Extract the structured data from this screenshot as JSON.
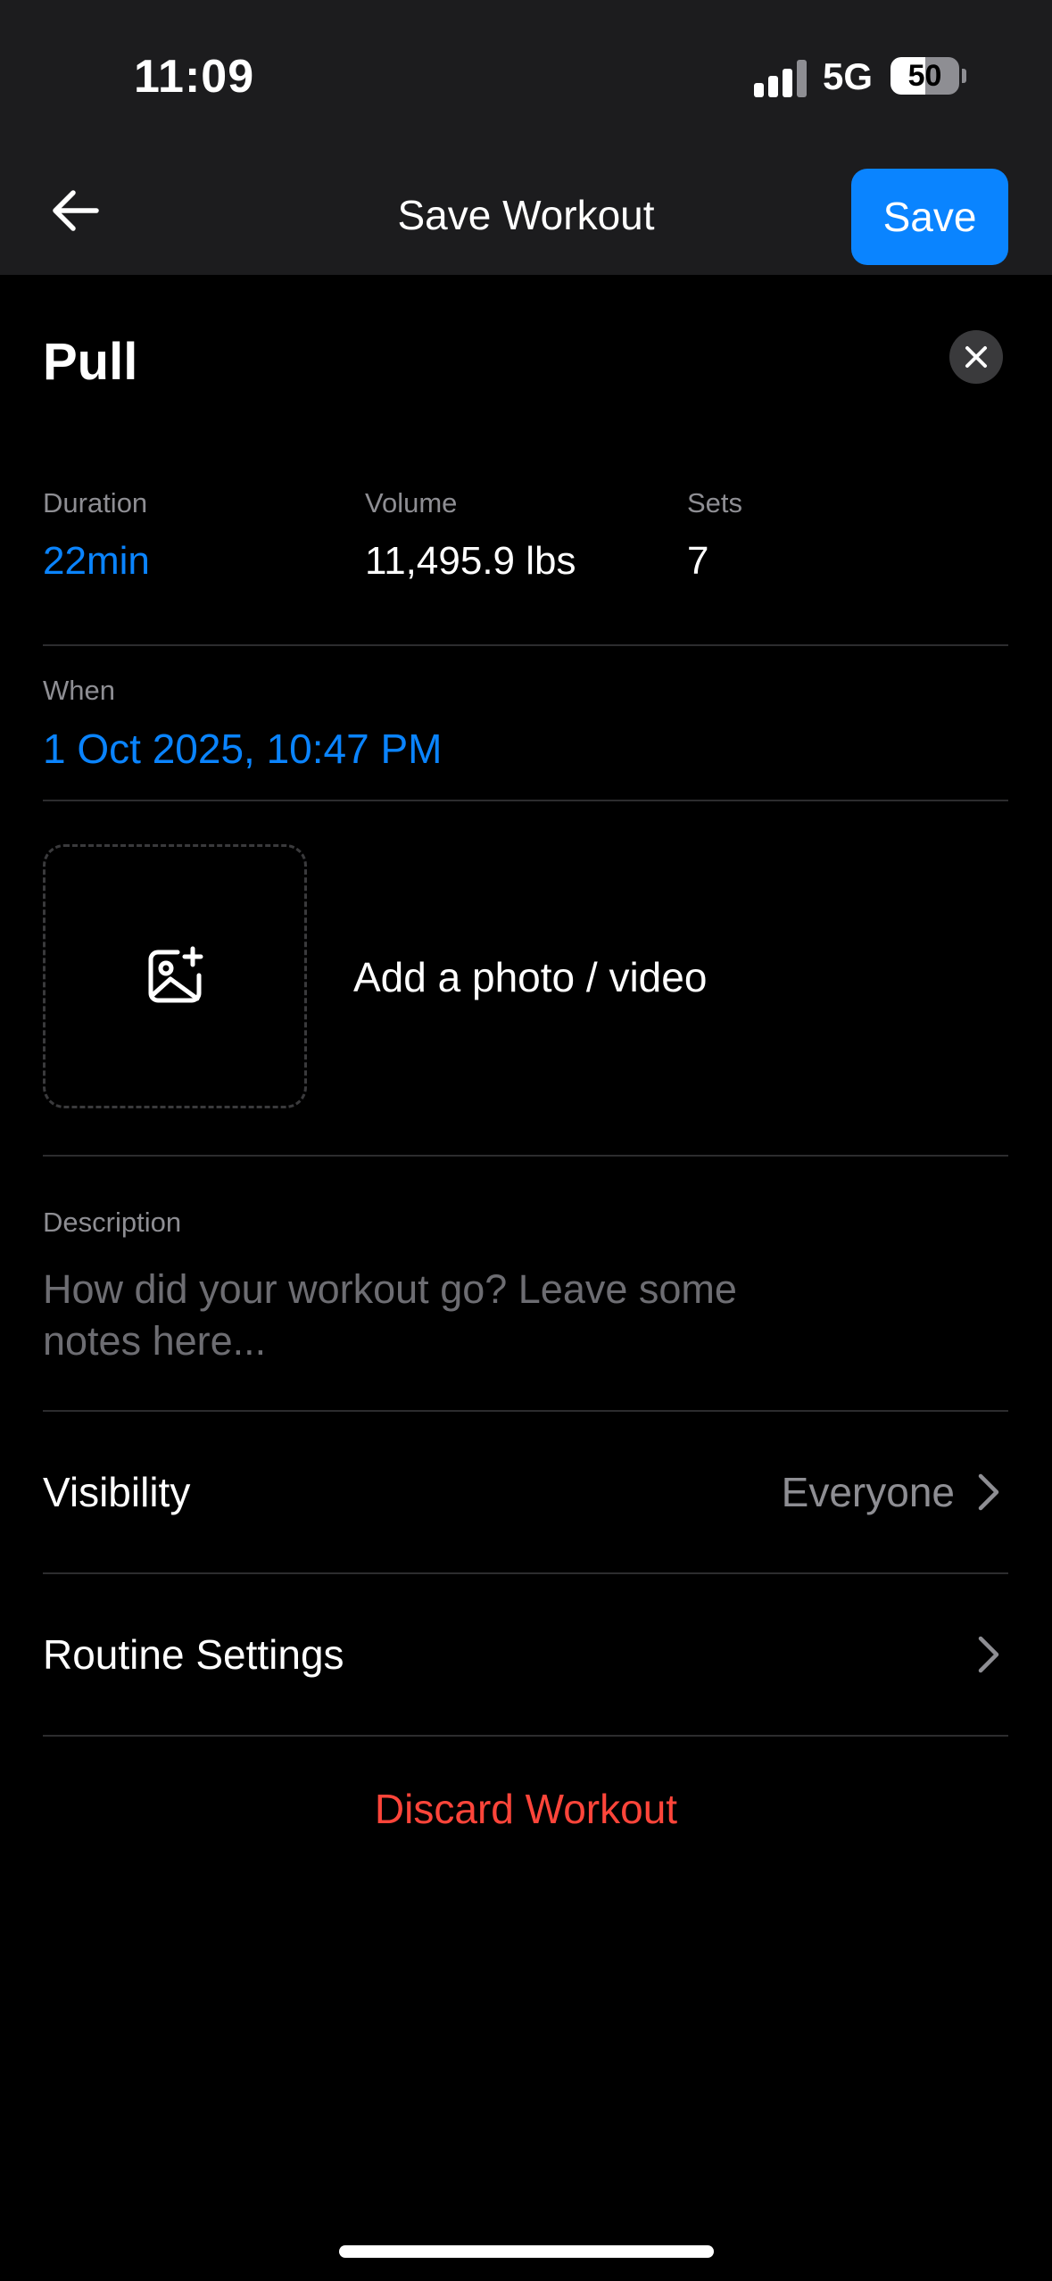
{
  "status_bar": {
    "time": "11:09",
    "network": "5G",
    "battery": "50",
    "battery_level": 0.5
  },
  "nav": {
    "title": "Save Workout",
    "save_label": "Save",
    "back_icon": "arrow-left-icon"
  },
  "workout": {
    "title": "Pull",
    "close_icon": "close-icon"
  },
  "stats": [
    {
      "label": "Duration",
      "value": "22min"
    },
    {
      "label": "Volume",
      "value": "11,495.9 lbs"
    },
    {
      "label": "Sets",
      "value": "7"
    }
  ],
  "when": {
    "label": "When",
    "value": "1 Oct 2025, 10:47 PM"
  },
  "media": {
    "label": "Add a photo / video",
    "icon": "add-photo-icon"
  },
  "description": {
    "label": "Description",
    "placeholder": "How did your workout go? Leave some notes here..."
  },
  "visibility": {
    "label": "Visibility",
    "value": "Everyone"
  },
  "routine_settings": {
    "label": "Routine Settings"
  },
  "discard_label": "Discard Workout",
  "colors": {
    "accent": "#0a84ff",
    "danger": "#ff453a",
    "background": "#000000",
    "header": "#1c1c1e"
  }
}
